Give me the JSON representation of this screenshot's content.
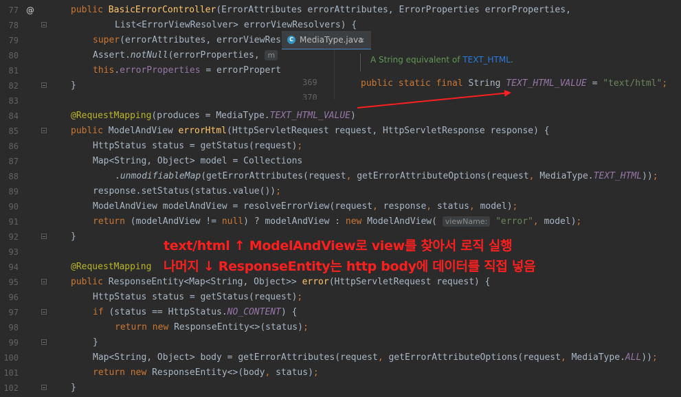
{
  "editor": {
    "lines": [
      {
        "num": "77",
        "marker": "@",
        "fold": false,
        "indent": 103,
        "tokens": [
          [
            "kw",
            "public "
          ],
          [
            "fn",
            "BasicErrorController"
          ],
          [
            "",
            "(ErrorAttributes errorAttributes, ErrorProperties errorProperties,"
          ]
        ]
      },
      {
        "num": "78",
        "fold": true,
        "indent": 167,
        "tokens": [
          [
            "",
            "List<ErrorViewResolver> errorViewResolvers) {"
          ]
        ]
      },
      {
        "num": "79",
        "fold": false,
        "indent": 135,
        "tokens": [
          [
            "kw",
            "super"
          ],
          [
            "",
            "(errorAttributes, errorViewRes"
          ]
        ]
      },
      {
        "num": "80",
        "fold": false,
        "indent": 135,
        "tokens": [
          [
            "",
            "Assert."
          ],
          [
            "it",
            "notNull"
          ],
          [
            "",
            "(errorProperties, "
          ],
          [
            "hint",
            "m"
          ]
        ]
      },
      {
        "num": "81",
        "fold": false,
        "indent": 135,
        "tokens": [
          [
            "kw",
            "this"
          ],
          [
            "",
            "."
          ],
          [
            "field",
            "errorProperties"
          ],
          [
            "",
            " = errorPropert"
          ]
        ]
      },
      {
        "num": "82",
        "fold": true,
        "indent": 103,
        "tokens": [
          [
            "",
            "}"
          ]
        ]
      },
      {
        "num": "83",
        "fold": false,
        "indent": 103,
        "tokens": []
      },
      {
        "num": "84",
        "fold": false,
        "indent": 103,
        "tokens": [
          [
            "ann",
            "@RequestMapping"
          ],
          [
            "",
            "(produces = MediaType."
          ],
          [
            "itf",
            "TEXT_HTML_VALUE"
          ],
          [
            "",
            ")"
          ]
        ]
      },
      {
        "num": "85",
        "fold": true,
        "indent": 103,
        "tokens": [
          [
            "kw",
            "public "
          ],
          [
            "",
            "ModelAndView "
          ],
          [
            "fn",
            "errorHtml"
          ],
          [
            "",
            "(HttpServletRequest request, HttpServletResponse response) {"
          ]
        ]
      },
      {
        "num": "86",
        "fold": false,
        "indent": 135,
        "tokens": [
          [
            "",
            "HttpStatus status = getStatus(request)"
          ],
          [
            "kw",
            ";"
          ]
        ]
      },
      {
        "num": "87",
        "fold": false,
        "indent": 135,
        "tokens": [
          [
            "",
            "Map<String, Object> model = Collections"
          ]
        ]
      },
      {
        "num": "88",
        "fold": false,
        "indent": 167,
        "tokens": [
          [
            "",
            "."
          ],
          [
            "it",
            "unmodifiableMap"
          ],
          [
            "",
            "(getErrorAttributes(request"
          ],
          [
            "kw",
            ", "
          ],
          [
            "",
            "getErrorAttributeOptions(request"
          ],
          [
            "kw",
            ", "
          ],
          [
            "",
            "MediaType."
          ],
          [
            "itf",
            "TEXT_HTML"
          ],
          [
            "",
            "))"
          ],
          [
            "kw",
            ";"
          ]
        ]
      },
      {
        "num": "89",
        "fold": false,
        "indent": 135,
        "tokens": [
          [
            "",
            "response.setStatus(status.value())"
          ],
          [
            "kw",
            ";"
          ]
        ]
      },
      {
        "num": "90",
        "fold": false,
        "indent": 135,
        "tokens": [
          [
            "",
            "ModelAndView modelAndView = resolveErrorView(request"
          ],
          [
            "kw",
            ", "
          ],
          [
            "",
            "response"
          ],
          [
            "kw",
            ", "
          ],
          [
            "",
            "status"
          ],
          [
            "kw",
            ", "
          ],
          [
            "",
            "model)"
          ],
          [
            "kw",
            ";"
          ]
        ]
      },
      {
        "num": "91",
        "fold": false,
        "indent": 135,
        "tokens": [
          [
            "kw",
            "return "
          ],
          [
            "",
            "(modelAndView != "
          ],
          [
            "kw",
            "null"
          ],
          [
            "",
            ") ? modelAndView : "
          ],
          [
            "kw",
            "new "
          ],
          [
            "",
            "ModelAndView( "
          ],
          [
            "hint",
            "viewName:"
          ],
          [
            "str",
            " \"error\""
          ],
          [
            "kw",
            ", "
          ],
          [
            "",
            "model)"
          ],
          [
            "kw",
            ";"
          ]
        ]
      },
      {
        "num": "92",
        "fold": true,
        "indent": 103,
        "tokens": [
          [
            "",
            "}"
          ]
        ]
      },
      {
        "num": "93",
        "fold": false,
        "indent": 103,
        "tokens": []
      },
      {
        "num": "94",
        "fold": false,
        "indent": 103,
        "tokens": [
          [
            "ann",
            "@RequestMapping"
          ]
        ]
      },
      {
        "num": "95",
        "fold": true,
        "indent": 103,
        "tokens": [
          [
            "kw",
            "public "
          ],
          [
            "",
            "ResponseEntity<Map<String, Object>> "
          ],
          [
            "fn",
            "error"
          ],
          [
            "",
            "(HttpServletRequest request) {"
          ]
        ]
      },
      {
        "num": "96",
        "fold": false,
        "indent": 135,
        "tokens": [
          [
            "",
            "HttpStatus status = getStatus(request)"
          ],
          [
            "kw",
            ";"
          ]
        ]
      },
      {
        "num": "97",
        "fold": true,
        "indent": 135,
        "tokens": [
          [
            "kw",
            "if "
          ],
          [
            "",
            "(status == HttpStatus."
          ],
          [
            "itf",
            "NO_CONTENT"
          ],
          [
            "",
            ") {"
          ]
        ]
      },
      {
        "num": "98",
        "fold": false,
        "indent": 167,
        "tokens": [
          [
            "kw",
            "return new "
          ],
          [
            "",
            "ResponseEntity<>(status)"
          ],
          [
            "kw",
            ";"
          ]
        ]
      },
      {
        "num": "99",
        "fold": true,
        "indent": 135,
        "tokens": [
          [
            "",
            "}"
          ]
        ]
      },
      {
        "num": "100",
        "fold": false,
        "indent": 135,
        "tokens": [
          [
            "",
            "Map<String, Object> body = getErrorAttributes(request"
          ],
          [
            "kw",
            ", "
          ],
          [
            "",
            "getErrorAttributeOptions(request"
          ],
          [
            "kw",
            ", "
          ],
          [
            "",
            "MediaType."
          ],
          [
            "itf",
            "ALL"
          ],
          [
            "",
            "))"
          ],
          [
            "kw",
            ";"
          ]
        ]
      },
      {
        "num": "101",
        "fold": false,
        "indent": 135,
        "tokens": [
          [
            "kw",
            "return new "
          ],
          [
            "",
            "ResponseEntity<>(body"
          ],
          [
            "kw",
            ", "
          ],
          [
            "",
            "status)"
          ],
          [
            "kw",
            ";"
          ]
        ]
      },
      {
        "num": "102",
        "fold": true,
        "indent": 103,
        "tokens": [
          [
            "",
            "}"
          ]
        ]
      }
    ]
  },
  "popup": {
    "tab_icon": "C",
    "tab_label": "MediaType.java",
    "tab_close": "×",
    "doc_prefix": "A String equivalent of ",
    "doc_link": "TEXT_HTML",
    "doc_suffix": ".",
    "line_num": "369",
    "line_num_next": "370",
    "code_kw": "public static final ",
    "code_type": "String ",
    "code_field": "TEXT_HTML_VALUE",
    "code_eq": " = ",
    "code_str": "\"text/html\"",
    "code_end": ";"
  },
  "annotations": {
    "line1": "text/html ↑ ModelAndView로 view를 찾아서 로직 실행",
    "line2": "나머지 ↓ ResponseEntity는 http body에 데이터를 직접 넣음",
    "color": "#ff1f1f"
  },
  "theme": {
    "background": "#2b2b2b",
    "keyword": "#cc7832",
    "method": "#ffc66d",
    "field": "#9876aa",
    "annotation": "#bbb529",
    "string": "#6a8759"
  }
}
